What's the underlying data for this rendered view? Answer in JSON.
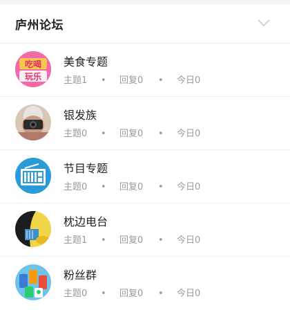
{
  "header": {
    "title": "庐州论坛"
  },
  "forums": [
    {
      "name": "美食专题",
      "avatar": "food-avatar",
      "topics": "主题1",
      "replies": "回复0",
      "today": "今日0"
    },
    {
      "name": "银发族",
      "avatar": "elderly-camera-avatar",
      "topics": "主题0",
      "replies": "回复0",
      "today": "今日0"
    },
    {
      "name": "节目专题",
      "avatar": "radio-icon",
      "topics": "主题0",
      "replies": "回复0",
      "today": "今日0"
    },
    {
      "name": "枕边电台",
      "avatar": "bedside-radio-avatar",
      "topics": "主题1",
      "replies": "回复0",
      "today": "今日0"
    },
    {
      "name": "粉丝群",
      "avatar": "fans-group-avatar",
      "topics": "主题0",
      "replies": "回复0",
      "today": "今日0"
    }
  ],
  "separator": "•",
  "avatar_texts": {
    "food_line1": "吃喝",
    "food_line2": "玩乐"
  },
  "colors": {
    "food_bg": "#f0569a",
    "radio_bg": "#2a9bd8",
    "bedside_bg": "#f2d44a",
    "fans_bg": "#6fc3e8"
  }
}
